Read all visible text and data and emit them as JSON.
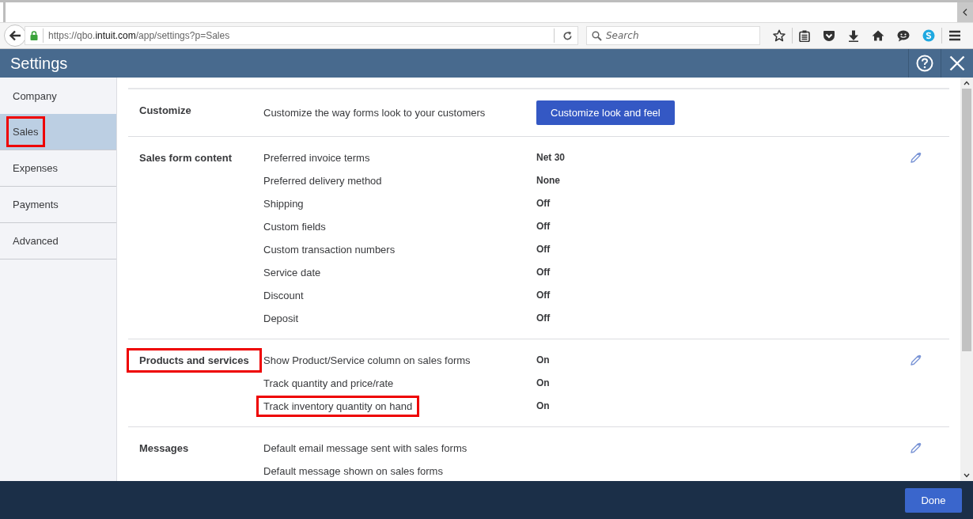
{
  "browser": {
    "url_scheme": "https://qbo.",
    "url_domain": "intuit.com",
    "url_path": "/app/settings?p=Sales",
    "search": {
      "placeholder": "Search"
    }
  },
  "header": {
    "title": "Settings"
  },
  "sidebar": {
    "items": [
      {
        "label": "Company",
        "selected": false,
        "highlighted": false
      },
      {
        "label": "Sales",
        "selected": true,
        "highlighted": true
      },
      {
        "label": "Expenses",
        "selected": false,
        "highlighted": false
      },
      {
        "label": "Payments",
        "selected": false,
        "highlighted": false
      },
      {
        "label": "Advanced",
        "selected": false,
        "highlighted": false
      }
    ]
  },
  "sections": [
    {
      "title": "Customize",
      "highlighted": false,
      "editable": false,
      "rows": [
        {
          "kind": "button",
          "label": "Customize the way forms look to your customers",
          "value": "Customize look and feel",
          "highlighted": false
        }
      ]
    },
    {
      "title": "Sales form content",
      "highlighted": false,
      "editable": true,
      "rows": [
        {
          "kind": "value",
          "label": "Preferred invoice terms",
          "value": "Net 30",
          "highlighted": false
        },
        {
          "kind": "value",
          "label": "Preferred delivery method",
          "value": "None",
          "highlighted": false
        },
        {
          "kind": "value",
          "label": "Shipping",
          "value": "Off",
          "highlighted": false
        },
        {
          "kind": "value",
          "label": "Custom fields",
          "value": "Off",
          "highlighted": false
        },
        {
          "kind": "value",
          "label": "Custom transaction numbers",
          "value": "Off",
          "highlighted": false
        },
        {
          "kind": "value",
          "label": "Service date",
          "value": "Off",
          "highlighted": false
        },
        {
          "kind": "value",
          "label": "Discount",
          "value": "Off",
          "highlighted": false
        },
        {
          "kind": "value",
          "label": "Deposit",
          "value": "Off",
          "highlighted": false
        }
      ]
    },
    {
      "title": "Products and services",
      "highlighted": true,
      "editable": true,
      "rows": [
        {
          "kind": "value",
          "label": "Show Product/Service column on sales forms",
          "value": "On",
          "highlighted": false
        },
        {
          "kind": "value",
          "label": "Track quantity and price/rate",
          "value": "On",
          "highlighted": false
        },
        {
          "kind": "value",
          "label": "Track inventory quantity on hand",
          "value": "On",
          "highlighted": true
        }
      ]
    },
    {
      "title": "Messages",
      "highlighted": false,
      "editable": true,
      "rows": [
        {
          "kind": "text",
          "label": "Default email message sent with sales forms",
          "highlighted": false
        },
        {
          "kind": "text",
          "label": "Default message shown on sales forms",
          "highlighted": false
        }
      ]
    }
  ],
  "footer": {
    "done_button": "Done"
  }
}
